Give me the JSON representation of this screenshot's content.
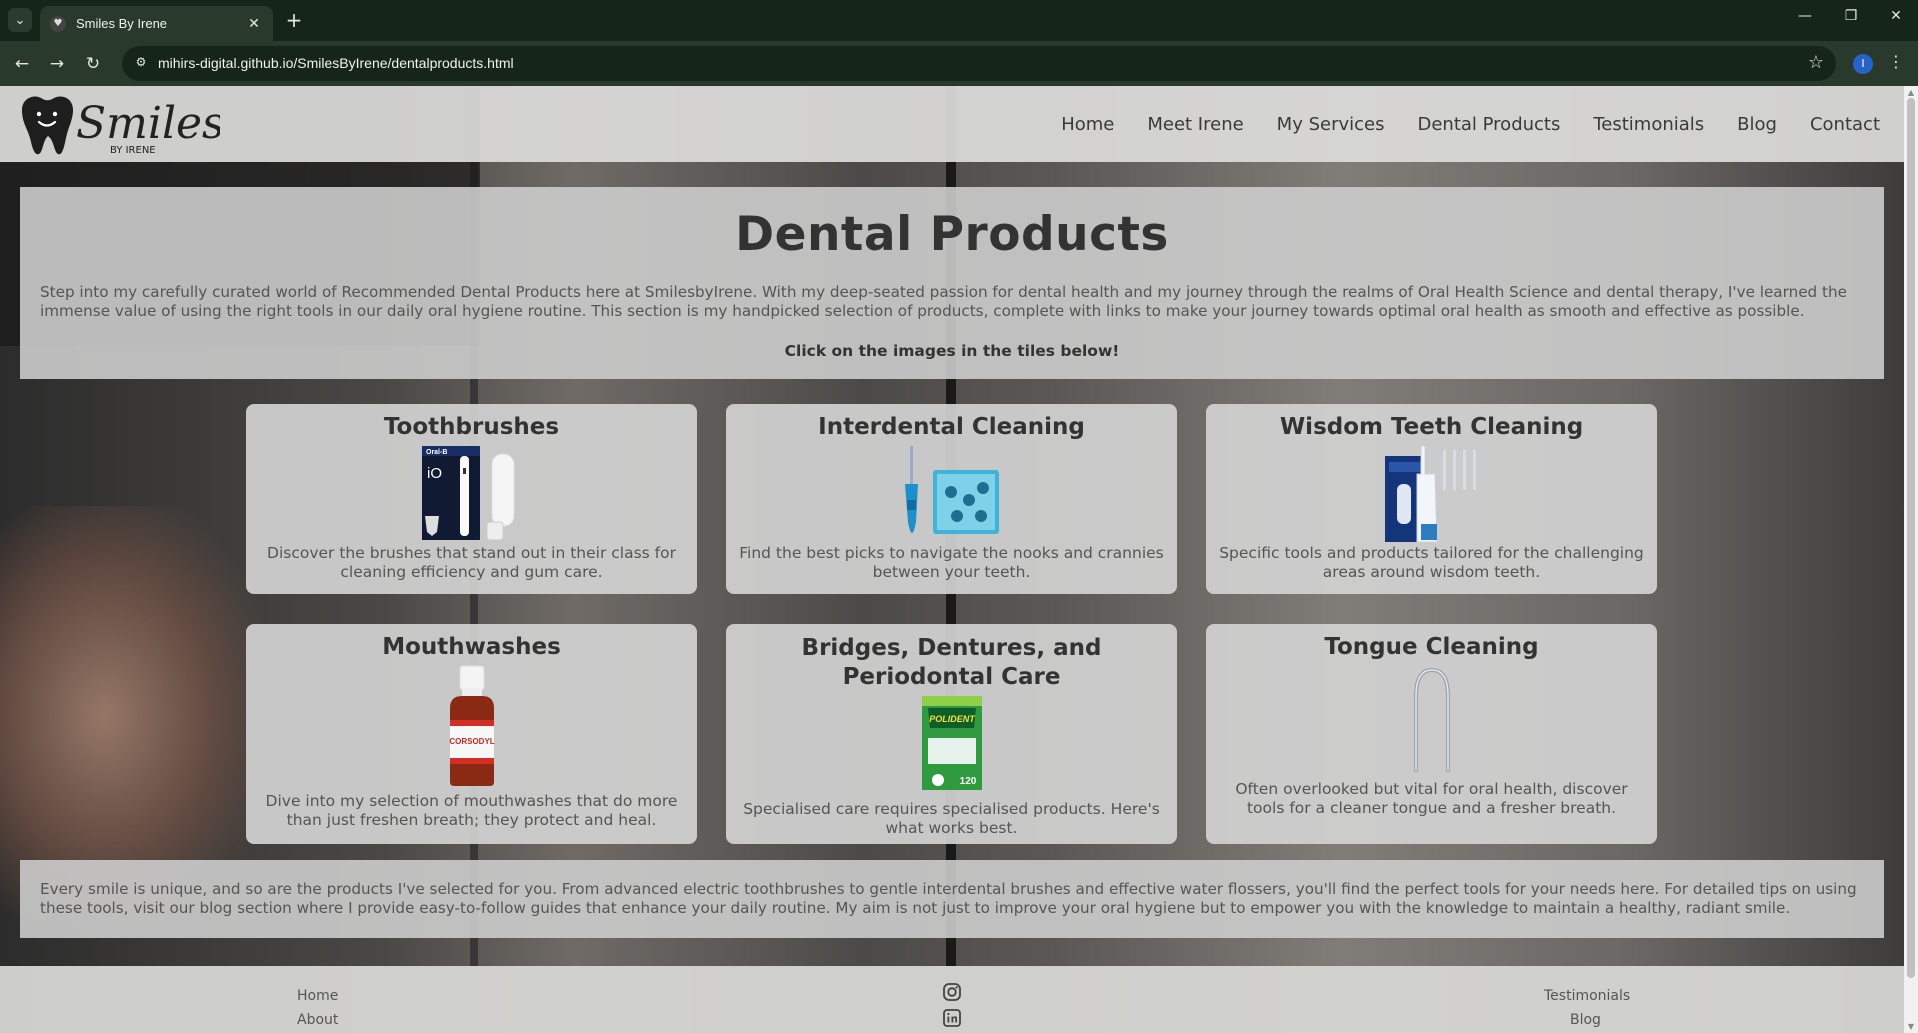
{
  "browser": {
    "tab_title": "Smiles By Irene",
    "tab_close": "✕",
    "new_tab": "+",
    "url": "mihirs-digital.github.io/SmilesByIrene/dentalproducts.html",
    "profile_initial": "I",
    "controls": {
      "minimize": "—",
      "restore": "❐",
      "close": "✕"
    },
    "icons": [
      "chevron-down-icon",
      "back-arrow-icon",
      "forward-arrow-icon",
      "reload-icon",
      "site-info-icon",
      "star-icon",
      "kebab-menu-icon"
    ]
  },
  "logo": {
    "script": "Smiles",
    "sub": "BY IRENE"
  },
  "nav": [
    "Home",
    "Meet Irene",
    "My Services",
    "Dental Products",
    "Testimonials",
    "Blog",
    "Contact"
  ],
  "intro": {
    "title": "Dental Products",
    "description": "Step into my carefully curated world of Recommended Dental Products here at SmilesbyIrene. With my deep-seated passion for dental health and my journey through the realms of Oral Health Science and dental therapy, I've learned the immense value of using the right tools in our daily oral hygiene routine. This section is my handpicked selection of products, complete with links to make your journey towards optimal oral health as smooth and effective as possible.",
    "cta": "Click on the images in the tiles below!"
  },
  "tiles": [
    {
      "title": "Toothbrushes",
      "text": "Discover the brushes that stand out in their class for cleaning efficiency and gum care.",
      "image": "electric-toothbrush-image",
      "box_text": "Oral-B",
      "box_model": "iO"
    },
    {
      "title": "Interdental Cleaning",
      "text": "Find the best picks to navigate the nooks and crannies between your teeth.",
      "image": "interdental-brush-image"
    },
    {
      "title": "Wisdom Teeth Cleaning",
      "text": "Specific tools and products tailored for the challenging areas around wisdom teeth.",
      "image": "water-flosser-image"
    },
    {
      "title": "Mouthwashes",
      "text": "Dive into my selection of mouthwashes that do more than just freshen breath; they protect and heal.",
      "image": "mouthwash-bottle-image",
      "brand": "CORSODYL"
    },
    {
      "title": "Bridges, Dentures, and Periodontal Care",
      "text": "Specialised care requires specialised products. Here's what works best.",
      "image": "denture-cleanser-box-image",
      "brand": "POLIDENT",
      "count": "120"
    },
    {
      "title": "Tongue Cleaning",
      "text": "Often overlooked but vital for oral health, discover tools for a cleaner tongue and a fresher breath.",
      "image": "tongue-scraper-image"
    }
  ],
  "outro": {
    "text": "Every smile is unique, and so are the products I've selected for you. From advanced electric toothbrushes to gentle interdental brushes and effective water flossers, you'll find the perfect tools for your needs here. For detailed tips on using these tools, visit our blog section where I provide easy-to-follow guides that enhance your daily routine. My aim is not just to improve your oral hygiene but to empower you with the knowledge to maintain a healthy, radiant smile."
  },
  "footer": {
    "left": [
      "Home",
      "About"
    ],
    "right": [
      "Testimonials",
      "Blog"
    ],
    "icons": [
      "instagram-icon",
      "linkedin-icon"
    ]
  },
  "colors": {
    "chrome_dark": "#15251a",
    "chrome_tab": "#293a2d",
    "panel": "#cccccc",
    "heading": "#333333",
    "body_text": "#555555"
  }
}
